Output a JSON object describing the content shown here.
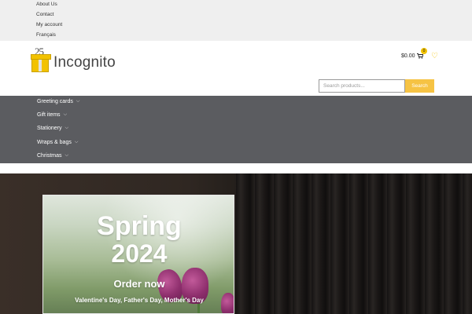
{
  "topbar": {
    "links": [
      "About Us",
      "Contact",
      "My account",
      "Français"
    ]
  },
  "logo": {
    "number": "25",
    "name": "Incognito"
  },
  "cart": {
    "amount": "$0.00",
    "count": "0"
  },
  "search": {
    "placeholder": "Search products...",
    "button": "Search"
  },
  "nav": {
    "items": [
      "Greeting cards",
      "Gift items",
      "Stationery",
      "Wraps & bags",
      "Christmas"
    ]
  },
  "promo": {
    "title_line1": "Spring",
    "title_line2": "2024",
    "cta": "Order now",
    "subtitle": "Valentine's Day, Father's Day, Mother's Day"
  },
  "colors": {
    "accent": "#f6c344",
    "nav_bg": "#5b5c60",
    "topbar_bg": "#efefef"
  }
}
